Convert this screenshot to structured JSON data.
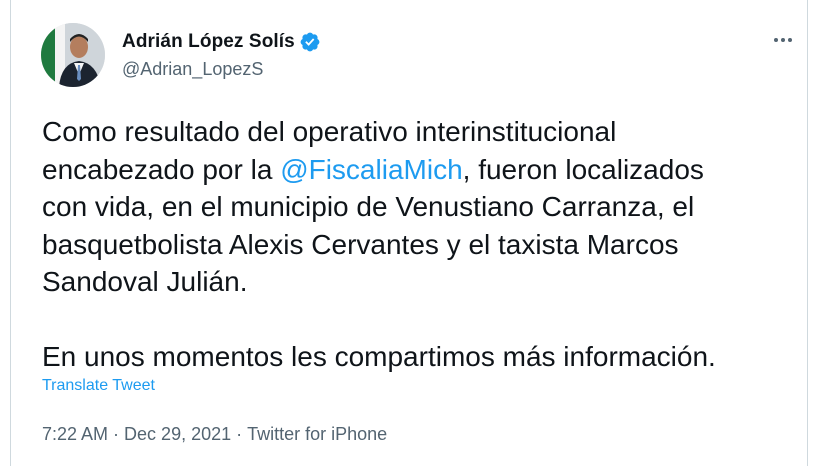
{
  "author": {
    "name": "Adrián López Solís",
    "handle": "@Adrian_LopezS",
    "verified": true,
    "avatar_icon": "profile-photo"
  },
  "tweet": {
    "line1": "Como resultado del operativo interinstitucional",
    "line2_before": "encabezado por la ",
    "mention": "@FiscaliaMich",
    "line2_after": ", fueron localizados",
    "line3": "con vida, en el municipio de Venustiano Carranza, el",
    "line4": "basquetbolista Alexis Cervantes y el taxista Marcos",
    "line5": "Sandoval Julián.",
    "line6": "En unos momentos les compartimos  más información."
  },
  "translate_label": "Translate Tweet",
  "meta": {
    "time": "7:22 AM",
    "date": "Dec 29, 2021",
    "source": "Twitter for iPhone",
    "separator": "·"
  },
  "colors": {
    "accent": "#1d9bf0",
    "text": "#0f1419",
    "secondary": "#536471",
    "border": "#cfd9de"
  }
}
